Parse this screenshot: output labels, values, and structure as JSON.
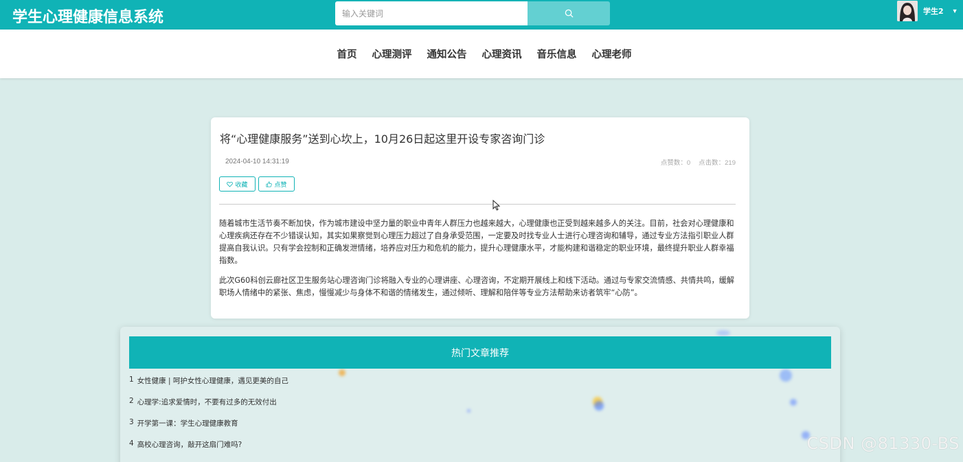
{
  "header": {
    "logo": "学生心理健康信息系统",
    "search_placeholder": "输入关键词",
    "user_name": "学生2"
  },
  "nav": {
    "items": [
      "首页",
      "心理测评",
      "通知公告",
      "心理资讯",
      "音乐信息",
      "心理老师"
    ]
  },
  "article": {
    "title": "将“心理健康服务”送到心坎上，10月26日起这里开设专家咨询门诊",
    "date": "2024-04-10 14:31:19",
    "likes_label": "点赞数：0",
    "clicks_label": "点击数：219",
    "collect_label": "收藏",
    "like_label": "点赞",
    "paragraphs": [
      "随着城市生活节奏不断加快，作为城市建设中坚力量的职业中青年人群压力也越来越大，心理健康也正受到越来越多人的关注。目前，社会对心理健康和心理疾病还存在不少错误认知，其实如果察觉到心理压力超过了自身承受范围，一定要及时找专业人士进行心理咨询和辅导，通过专业方法指引职业人群提高自我认识。只有学会控制和正确发泄情绪，培养应对压力和危机的能力，提升心理健康水平，才能构建和谐稳定的职业环境，最终提升职业人群幸福指数。",
      "此次G60科创云廊社区卫生服务站心理咨询门诊将融入专业的心理讲座、心理咨询，不定期开展线上和线下活动。通过与专家交流情感、共情共鸣，缓解职场人情绪中的紧张、焦虑，慢慢减少与身体不和谐的情绪发生，通过倾听、理解和陪伴等专业方法帮助来访者筑牢“心防”。"
    ]
  },
  "hot": {
    "title": "热门文章推荐",
    "items": [
      {
        "num": "1",
        "text": "女性健康 | 呵护女性心理健康，遇见更美的自己"
      },
      {
        "num": "2",
        "text": "心理学:追求爱情时，不要有过多的无效付出"
      },
      {
        "num": "3",
        "text": "开学第一课：学生心理健康教育"
      },
      {
        "num": "4",
        "text": "高校心理咨询，敲开这扇门难吗?"
      }
    ]
  },
  "watermark": "CSDN @81330-BS",
  "colors": {
    "primary": "#10b3b6",
    "search_button": "#63d0d2",
    "page_background": "#d9ecea"
  }
}
